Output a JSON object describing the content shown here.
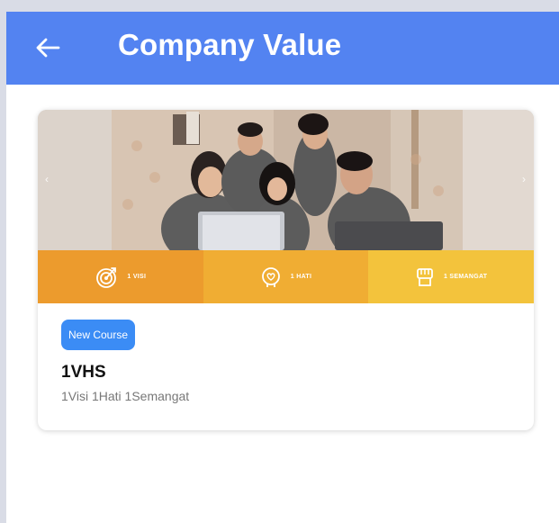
{
  "appbar": {
    "title": "Company Value",
    "back_icon": "arrow-left-icon"
  },
  "colors": {
    "appbar": "#5383f1",
    "badge": "#3b8cf5",
    "strip_1": "#ec9b2d",
    "strip_2": "#f0ad33",
    "strip_3": "#f3c33c"
  },
  "banner": {
    "values": [
      {
        "label": "1 VISI",
        "icon": "target-icon"
      },
      {
        "label": "1 HATI",
        "icon": "heart-icon"
      },
      {
        "label": "1 SEMANGAT",
        "icon": "fist-icon"
      }
    ]
  },
  "course": {
    "badge": "New Course",
    "name": "1VHS",
    "subtitle": "1Visi 1Hati 1Semangat"
  }
}
